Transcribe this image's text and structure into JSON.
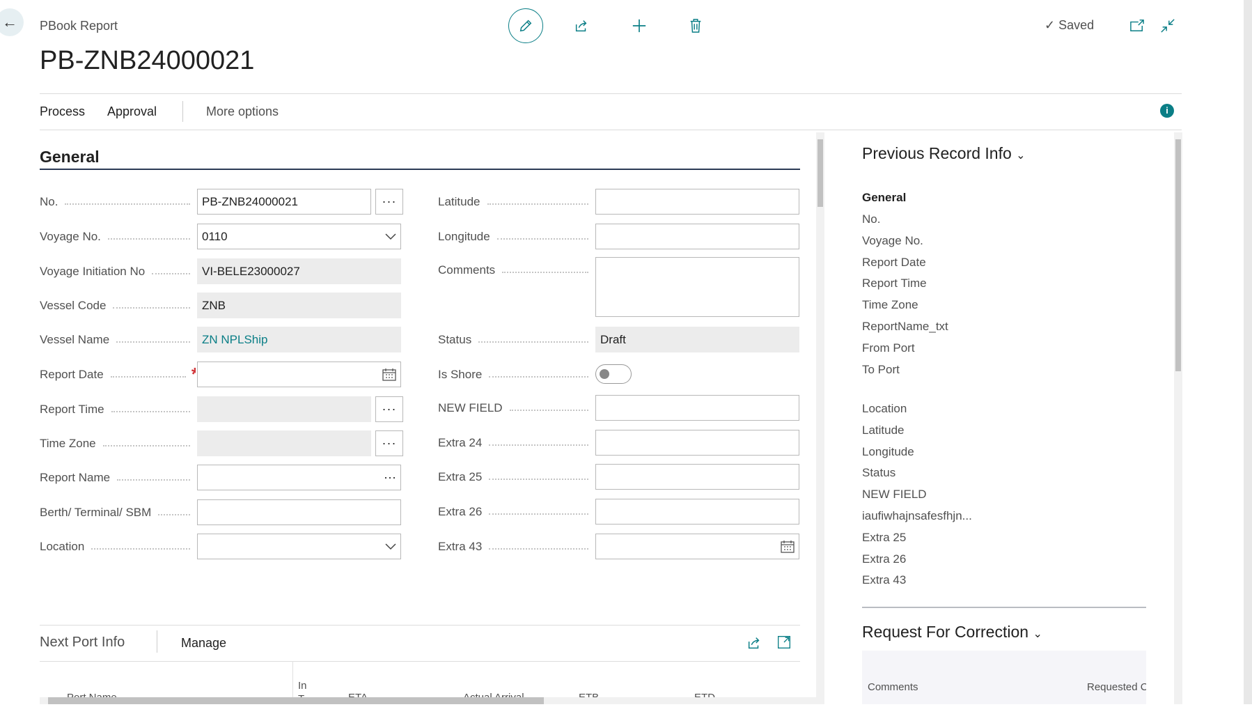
{
  "header": {
    "breadcrumb": "PBook Report",
    "title": "PB-ZNB24000021",
    "status": "Saved",
    "icons": [
      "back-arrow-icon",
      "edit-pencil-icon",
      "share-icon",
      "plus-icon",
      "trash-icon",
      "checkmark-icon",
      "open-new-window-icon",
      "collapse-icon"
    ]
  },
  "tabs": {
    "process": "Process",
    "approval": "Approval",
    "more": "More options"
  },
  "general": {
    "heading": "General",
    "left": [
      {
        "label": "No.",
        "value": "PB-ZNB24000021",
        "type": "text",
        "ellipsis": true
      },
      {
        "label": "Voyage No.",
        "value": "0110",
        "type": "dropdown"
      },
      {
        "label": "Voyage Initiation No",
        "value": "VI-BELE23000027",
        "type": "readonly"
      },
      {
        "label": "Vessel Code",
        "value": "ZNB",
        "type": "readonly"
      },
      {
        "label": "Vessel Name",
        "value": "ZN NPLShip",
        "type": "readonly-link"
      },
      {
        "label": "Report Date",
        "value": "",
        "type": "date",
        "required": true
      },
      {
        "label": "Report Time",
        "value": "",
        "type": "readonly",
        "ellipsis": true
      },
      {
        "label": "Time Zone",
        "value": "",
        "type": "readonly",
        "ellipsis": true
      },
      {
        "label": "Report Name",
        "value": "",
        "type": "inline-ellipsis"
      },
      {
        "label": "Berth/ Terminal/ SBM",
        "value": "",
        "type": "text"
      },
      {
        "label": "Location",
        "value": "",
        "type": "dropdown"
      }
    ],
    "right": [
      {
        "label": "Latitude",
        "value": "",
        "type": "text"
      },
      {
        "label": "Longitude",
        "value": "",
        "type": "text"
      },
      {
        "label": "Comments",
        "value": "",
        "type": "textarea"
      },
      {
        "label": "Status",
        "value": "Draft",
        "type": "readonly"
      },
      {
        "label": "Is Shore",
        "value": false,
        "type": "toggle"
      },
      {
        "label": "NEW FIELD",
        "value": "",
        "type": "text"
      },
      {
        "label": "Extra 24",
        "value": "",
        "type": "text"
      },
      {
        "label": "Extra 25",
        "value": "",
        "type": "text"
      },
      {
        "label": "Extra 26",
        "value": "",
        "type": "text"
      },
      {
        "label": "Extra 43",
        "value": "",
        "type": "date"
      }
    ]
  },
  "next_port": {
    "heading": "Next Port Info",
    "manage": "Manage",
    "columns": [
      "Port Name",
      "In T",
      "ETA",
      "Actual Arrival",
      "ETB",
      "ETD"
    ]
  },
  "factbox": {
    "heading": "Previous Record Info",
    "group1_title": "General",
    "group1": [
      "No.",
      "Voyage No.",
      "Report Date",
      "Report Time",
      "Time Zone",
      "ReportName_txt",
      "From Port",
      "To Port"
    ],
    "group2": [
      "Location",
      "Latitude",
      "Longitude",
      "Status",
      "NEW FIELD",
      "iaufiwhajnsafesfhjn...",
      "Extra 25",
      "Extra 26",
      "Extra 43"
    ],
    "correction": {
      "heading": "Request For Correction",
      "columns": [
        "Comments",
        "Requested C"
      ]
    }
  },
  "colors": {
    "accent": "#0a7e86",
    "required": "#d13438"
  }
}
